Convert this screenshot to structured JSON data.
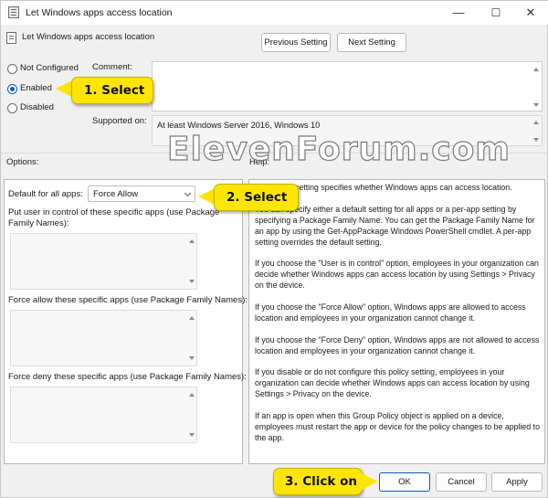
{
  "window": {
    "title": "Let Windows apps access location",
    "controls": {
      "minimize": "—",
      "maximize": "☐",
      "close": "✕"
    }
  },
  "header": {
    "policy_name": "Let Windows apps access location",
    "previous_button": "Previous Setting",
    "next_button": "Next Setting"
  },
  "state": {
    "options": [
      {
        "label": "Not Configured",
        "checked": false
      },
      {
        "label": "Enabled",
        "checked": true
      },
      {
        "label": "Disabled",
        "checked": false
      }
    ]
  },
  "comment": {
    "label": "Comment:",
    "value": ""
  },
  "supported": {
    "label": "Supported on:",
    "value": "At least Windows Server 2016, Windows 10"
  },
  "section_labels": {
    "options": "Options:",
    "help": "Help:"
  },
  "options_panel": {
    "default_label": "Default for all apps:",
    "default_value": "Force Allow",
    "user_control_label": "Put user in control of these specific apps (use Package Family Names):",
    "force_allow_label": "Force allow these specific apps (use Package Family Names):",
    "force_deny_label": "Force deny these specific apps (use Package Family Names):"
  },
  "help_panel": {
    "paragraphs": [
      "This policy setting specifies whether Windows apps can access location.",
      "You can specify either a default setting for all apps or a per-app setting by specifying a Package Family Name. You can get the Package Family Name for an app by using the Get-AppPackage Windows PowerShell cmdlet. A per-app setting overrides the default setting.",
      "If you choose the \"User is in control\" option, employees in your organization can decide whether Windows apps can access location by using Settings > Privacy on the device.",
      "If you choose the \"Force Allow\" option, Windows apps are allowed to access location and employees in your organization cannot change it.",
      "If you choose the \"Force Deny\" option, Windows apps are not allowed to access location and employees in your organization cannot change it.",
      "If you disable or do not configure this policy setting, employees in your organization can decide whether Windows apps can access location by using Settings > Privacy on the device.",
      "If an app is open when this Group Policy object is applied on a device, employees must restart the app or device for the policy changes to be applied to the app."
    ]
  },
  "footer": {
    "ok": "OK",
    "cancel": "Cancel",
    "apply": "Apply"
  },
  "watermark": "ElevenForum.com",
  "annotations": {
    "step1": "1. Select",
    "step2": "2. Select",
    "step3": "3. Click on"
  },
  "colors": {
    "accent": "#0f5aba",
    "callout": "#ffe600"
  }
}
